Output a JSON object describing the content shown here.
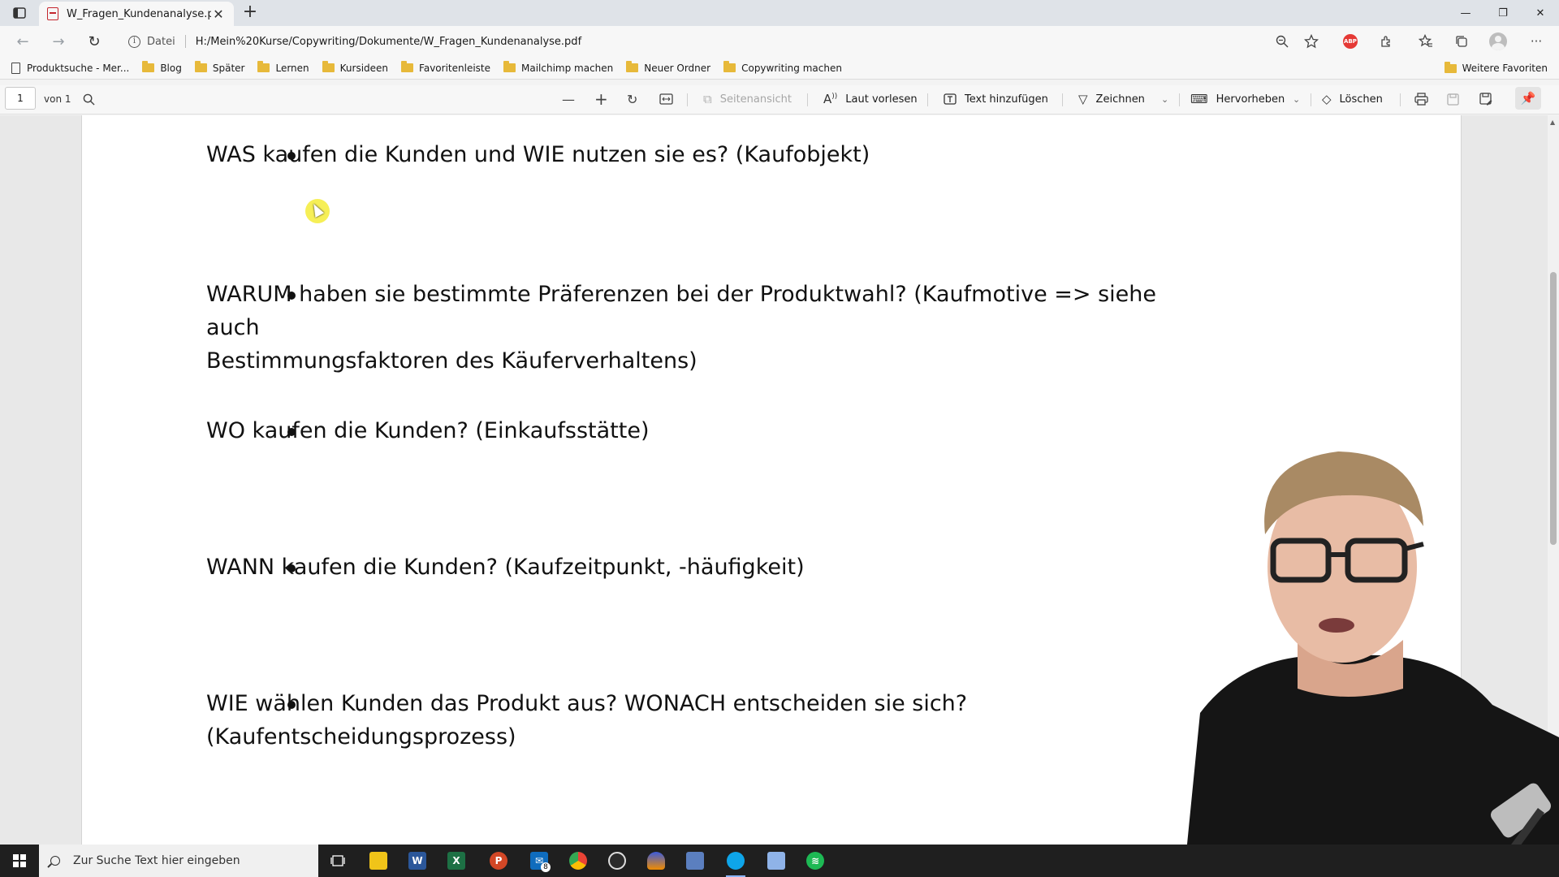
{
  "tab": {
    "title": "W_Fragen_Kundenanalyse.pdf",
    "close": "✕",
    "new_tab": "+"
  },
  "window_controls": {
    "minimize": "—",
    "restore": "❐",
    "close": "✕"
  },
  "address": {
    "scheme_label": "Datei",
    "url": "H:/Mein%20Kurse/Copywriting/Dokumente/W_Fragen_Kundenanalyse.pdf"
  },
  "bookmarks": {
    "items": [
      {
        "label": "Produktsuche - Mer...",
        "icon": "page-icon"
      },
      {
        "label": "Blog",
        "icon": "folder-icon"
      },
      {
        "label": "Später",
        "icon": "folder-icon"
      },
      {
        "label": "Lernen",
        "icon": "folder-icon"
      },
      {
        "label": "Kursideen",
        "icon": "folder-icon"
      },
      {
        "label": "Favoritenleiste",
        "icon": "folder-icon"
      },
      {
        "label": "Mailchimp machen",
        "icon": "folder-icon"
      },
      {
        "label": "Neuer Ordner",
        "icon": "folder-icon"
      },
      {
        "label": "Copywriting machen",
        "icon": "folder-icon"
      }
    ],
    "other": "Weitere Favoriten"
  },
  "pdf_toolbar": {
    "page_number": "1",
    "page_of": "von 1",
    "page_view": "Seitenansicht",
    "read_aloud": "Laut vorlesen",
    "add_text": "Text hinzufügen",
    "draw": "Zeichnen",
    "highlight": "Hervorheben",
    "erase": "Löschen"
  },
  "document": {
    "items": [
      {
        "lines": [
          "WAS kaufen die Kunden und WIE nutzen sie es? (Kaufobjekt)"
        ]
      },
      {
        "lines": [
          "WARUM haben sie bestimmte Präferenzen bei der Produktwahl? (Kaufmotive => siehe auch",
          "Bestimmungsfaktoren des Käuferverhaltens)"
        ]
      },
      {
        "lines": [
          "WO kaufen die Kunden? (Einkaufsstätte)"
        ]
      },
      {
        "lines": [
          "WANN kaufen die Kunden? (Kaufzeitpunkt, -häufigkeit)"
        ]
      },
      {
        "lines": [
          "WIE wählen Kunden das Produkt aus? WONACH entscheiden sie sich?",
          "(Kaufentscheidungsprozess)"
        ]
      }
    ]
  },
  "taskbar": {
    "search_placeholder": "Zur Suche Text hier eingeben",
    "mail_badge": "8",
    "colors": {
      "excel": "#1d7044",
      "word": "#2b579a",
      "powerpoint": "#d24726",
      "spotify": "#1db954",
      "chrome": "#fbbc05",
      "edge": "#0ea5e9"
    }
  }
}
